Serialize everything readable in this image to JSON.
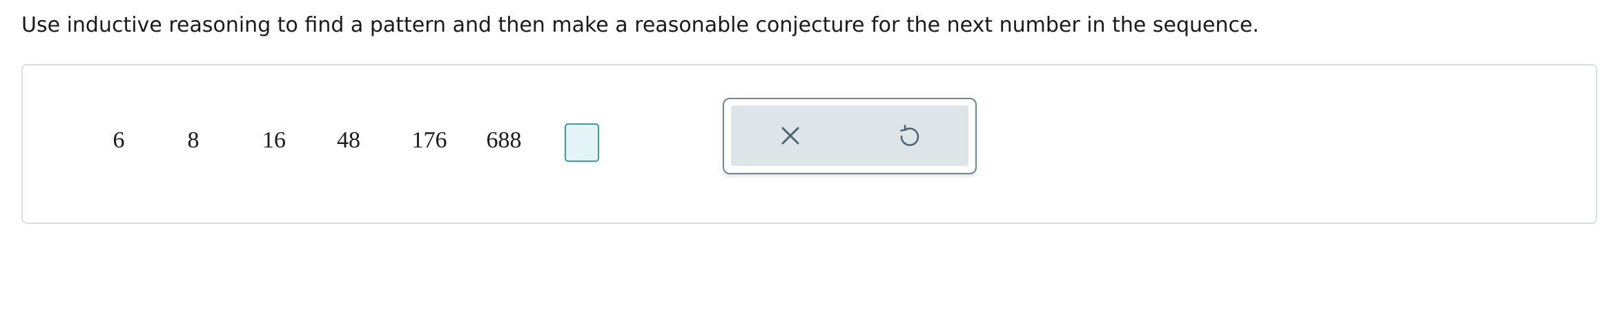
{
  "question": {
    "prompt": "Use inductive reasoning to find a pattern and then make a reasonable conjecture for the next number in the sequence."
  },
  "sequence": [
    "6",
    "8",
    "16",
    "48",
    "176",
    "688"
  ],
  "answer": {
    "value": ""
  },
  "keypad": {
    "clear_icon": "close-icon",
    "undo_icon": "undo-icon"
  },
  "colors": {
    "input_border": "#3e9c9a",
    "input_fill": "#e3f3f6",
    "keypad_fill": "#dee5e8",
    "icon_color": "#4a6572"
  }
}
